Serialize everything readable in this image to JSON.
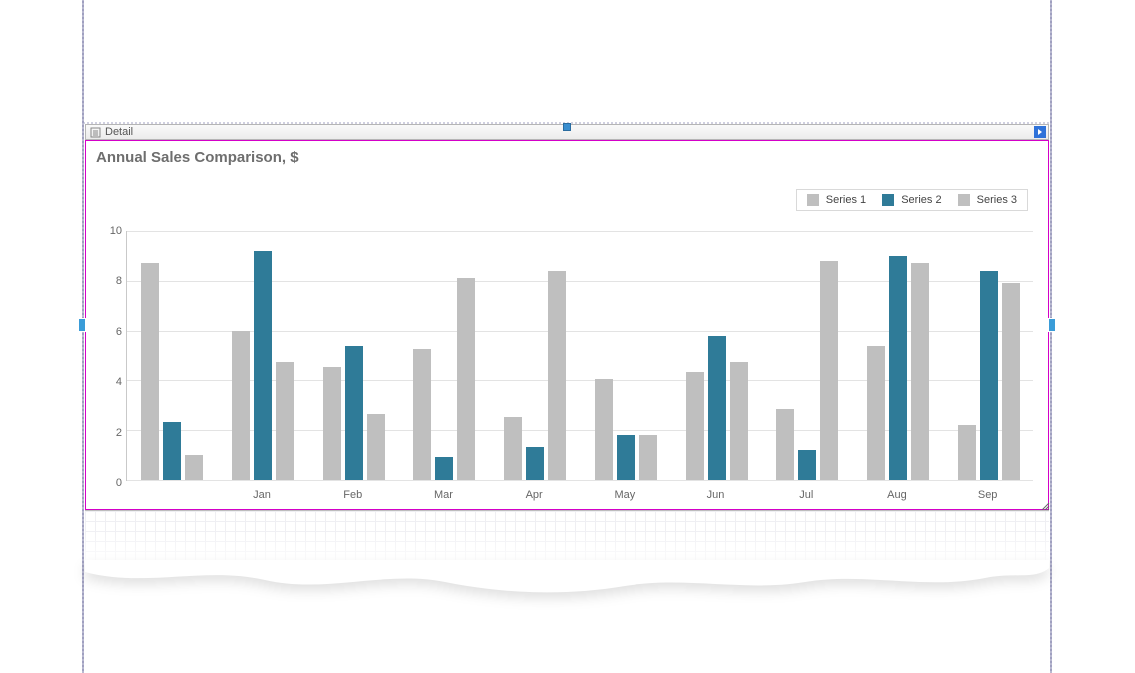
{
  "band": {
    "label": "Detail"
  },
  "chart": {
    "title": "Annual Sales Comparison, $"
  },
  "legend": {
    "s1": "Series 1",
    "s2": "Series 2",
    "s3": "Series 3"
  },
  "colors": {
    "series1": "#bfbfbf",
    "series2": "#2f7b98",
    "series3": "#bfbfbf"
  },
  "axis": {
    "y": [
      "0",
      "2",
      "4",
      "6",
      "8",
      "10"
    ],
    "x": [
      "",
      "Jan",
      "Feb",
      "Mar",
      "Apr",
      "May",
      "Jun",
      "Jul",
      "Aug",
      "Sep"
    ]
  },
  "chart_data": {
    "type": "bar",
    "title": "Annual Sales Comparison, $",
    "ylabel": "",
    "xlabel": "",
    "ylim": [
      0,
      10
    ],
    "categories": [
      "",
      "Jan",
      "Feb",
      "Mar",
      "Apr",
      "May",
      "Jun",
      "Jul",
      "Aug",
      "Sep"
    ],
    "series": [
      {
        "name": "Series 1",
        "color": "#bfbfbf",
        "values": [
          8.6,
          5.9,
          4.5,
          5.2,
          2.5,
          4.0,
          4.3,
          2.8,
          5.3,
          2.2
        ]
      },
      {
        "name": "Series 2",
        "color": "#2f7b98",
        "values": [
          2.3,
          9.1,
          5.3,
          0.9,
          1.3,
          1.8,
          5.7,
          1.2,
          8.9,
          8.3
        ]
      },
      {
        "name": "Series 3",
        "color": "#bfbfbf",
        "values": [
          1.0,
          4.7,
          2.6,
          8.0,
          8.3,
          1.8,
          4.7,
          8.7,
          8.6,
          7.8
        ]
      }
    ],
    "legend_position": "top-right",
    "grid": true
  }
}
